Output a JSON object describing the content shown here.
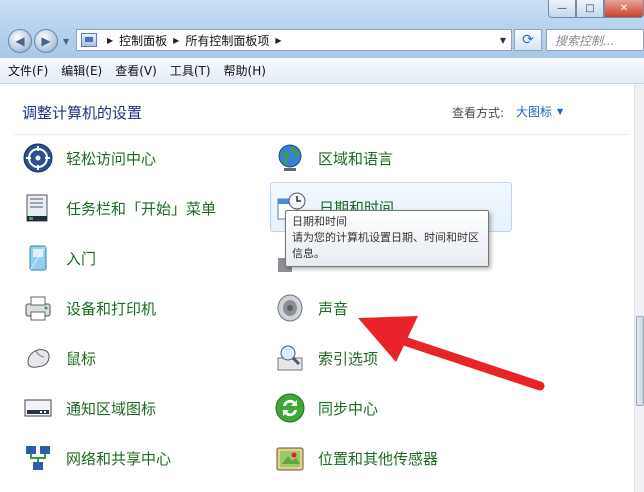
{
  "window": {
    "minimize_glyph": "—",
    "maximize_glyph": "□",
    "close_glyph": "✕"
  },
  "address_bar": {
    "breadcrumbs": [
      "控制面板",
      "所有控制面板项"
    ],
    "search_placeholder": "搜索控制..."
  },
  "menubar": {
    "items": [
      "文件(F)",
      "编辑(E)",
      "查看(V)",
      "工具(T)",
      "帮助(H)"
    ]
  },
  "content": {
    "title": "调整计算机的设置",
    "view_by_label": "查看方式:",
    "view_by_value": "大图标"
  },
  "items_left": [
    {
      "label": "轻松访问中心",
      "icon": "ease-of-access-icon"
    },
    {
      "label": "任务栏和「开始」菜单",
      "icon": "taskbar-icon"
    },
    {
      "label": "入门",
      "icon": "getting-started-icon"
    },
    {
      "label": "设备和打印机",
      "icon": "printer-icon"
    },
    {
      "label": "鼠标",
      "icon": "mouse-icon"
    },
    {
      "label": "通知区域图标",
      "icon": "notification-area-icon"
    },
    {
      "label": "网络和共享中心",
      "icon": "network-icon"
    }
  ],
  "items_right": [
    {
      "label": "区域和语言",
      "icon": "globe-icon"
    },
    {
      "label": "日期和时间",
      "icon": "calendar-clock-icon"
    },
    {
      "label": "",
      "icon": "hidden-item-icon"
    },
    {
      "label": "声音",
      "icon": "speaker-icon"
    },
    {
      "label": "索引选项",
      "icon": "indexing-icon"
    },
    {
      "label": "同步中心",
      "icon": "sync-icon"
    },
    {
      "label": "位置和其他传感器",
      "icon": "location-sensor-icon"
    }
  ],
  "tooltip": {
    "title": "日期和时间",
    "description": "请为您的计算机设置日期、时间和时区信息。"
  },
  "colors": {
    "item_text": "#1d6b23",
    "title_text": "#1e3287",
    "link_text": "#1b63c4",
    "annotation_arrow": "#e8232a"
  }
}
